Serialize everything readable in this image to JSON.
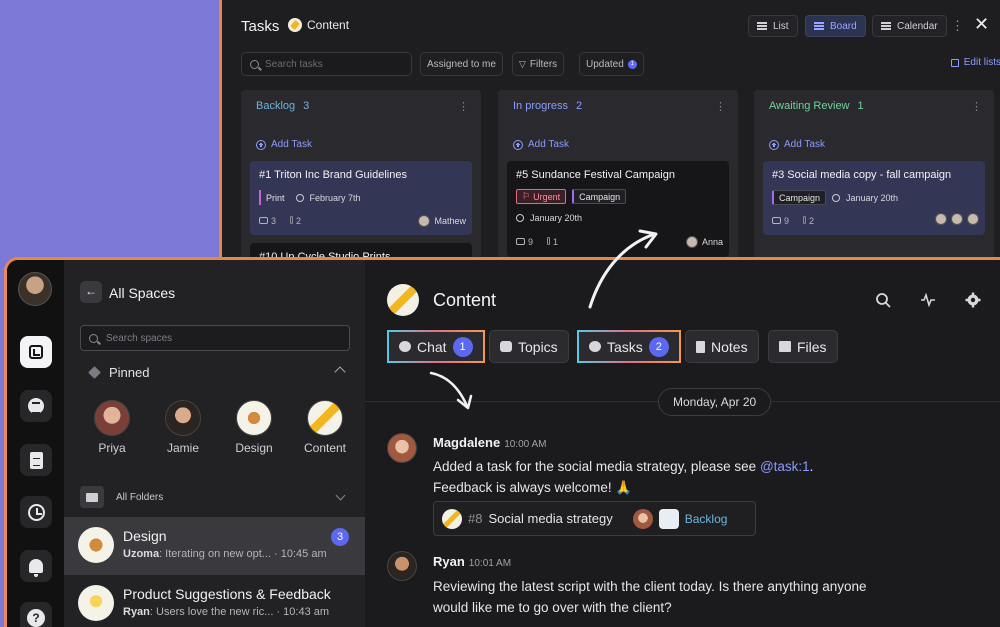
{
  "tasks_panel": {
    "title": "Tasks",
    "crumb": "Content",
    "views": [
      "List",
      "Board",
      "Calendar"
    ],
    "search_placeholder": "Search tasks",
    "assigned_to_me": "Assigned to me",
    "filters": "Filters",
    "updated": "Updated",
    "updated_badge": "1",
    "edit_lists": "Edit lists",
    "columns": [
      {
        "name": "Backlog",
        "count": "3",
        "color": "#6fb3d9",
        "add_task": "Add Task",
        "cards": [
          {
            "title": "#1  Triton Inc Brand Guidelines",
            "tag": "Print",
            "date": "February 7th",
            "comments": "3",
            "attachments": "2",
            "assignee": "Mathew"
          },
          {
            "title": "#10  Up Cycle Studio Prints"
          }
        ]
      },
      {
        "name": "In progress",
        "count": "2",
        "color": "#8c9cff",
        "add_task": "Add Task",
        "cards": [
          {
            "title": "#5  Sundance Festival Campaign",
            "tag_urgent": "Urgent",
            "tag": "Campaign",
            "date": "January 20th",
            "comments": "9",
            "attachments": "1",
            "assignee": "Anna"
          }
        ]
      },
      {
        "name": "Awaiting Review",
        "count": "1",
        "color": "#6fd39b",
        "add_task": "Add Task",
        "cards": [
          {
            "title": "#3  Social media copy - fall campaign",
            "tag": "Campaign",
            "date": "January 20th",
            "comments": "9",
            "attachments": "2"
          }
        ]
      }
    ]
  },
  "sidebar": {
    "title": "All Spaces",
    "search_placeholder": "Search spaces",
    "pinned_label": "Pinned",
    "pinned": [
      {
        "label": "Priya"
      },
      {
        "label": "Jamie"
      },
      {
        "label": "Design"
      },
      {
        "label": "Content"
      }
    ],
    "all_folders": "All Folders",
    "spaces": [
      {
        "name": "Design",
        "preview_author": "Uzoma",
        "preview_text": ": Iterating on new opt... · 10:45 am",
        "badge": "3"
      },
      {
        "name": "Product Suggestions & Feedback",
        "preview_author": "Ryan",
        "preview_text": ": Users love the new ric... · 10:43 am"
      }
    ]
  },
  "main": {
    "title": "Content",
    "tabs": [
      {
        "label": "Chat",
        "badge": "1"
      },
      {
        "label": "Topics"
      },
      {
        "label": "Tasks",
        "badge": "2"
      },
      {
        "label": "Notes"
      },
      {
        "label": "Files"
      }
    ],
    "date_divider": "Monday, Apr 20",
    "messages": [
      {
        "author": "Magdalene",
        "time": "10:00 AM",
        "text_1": "Added a task for the social media strategy, please see ",
        "mention": "@task:1",
        "text_1_end": ".",
        "text_2": "Feedback is always welcome! 🙏",
        "task_ref": {
          "hash": "#8",
          "title": "Social media strategy",
          "status": "Backlog"
        }
      },
      {
        "author": "Ryan",
        "time": "10:01 AM",
        "text_1": "Reviewing the latest script with the client today. Is there anything anyone",
        "text_2": "would like me to go over with the client?"
      }
    ]
  }
}
